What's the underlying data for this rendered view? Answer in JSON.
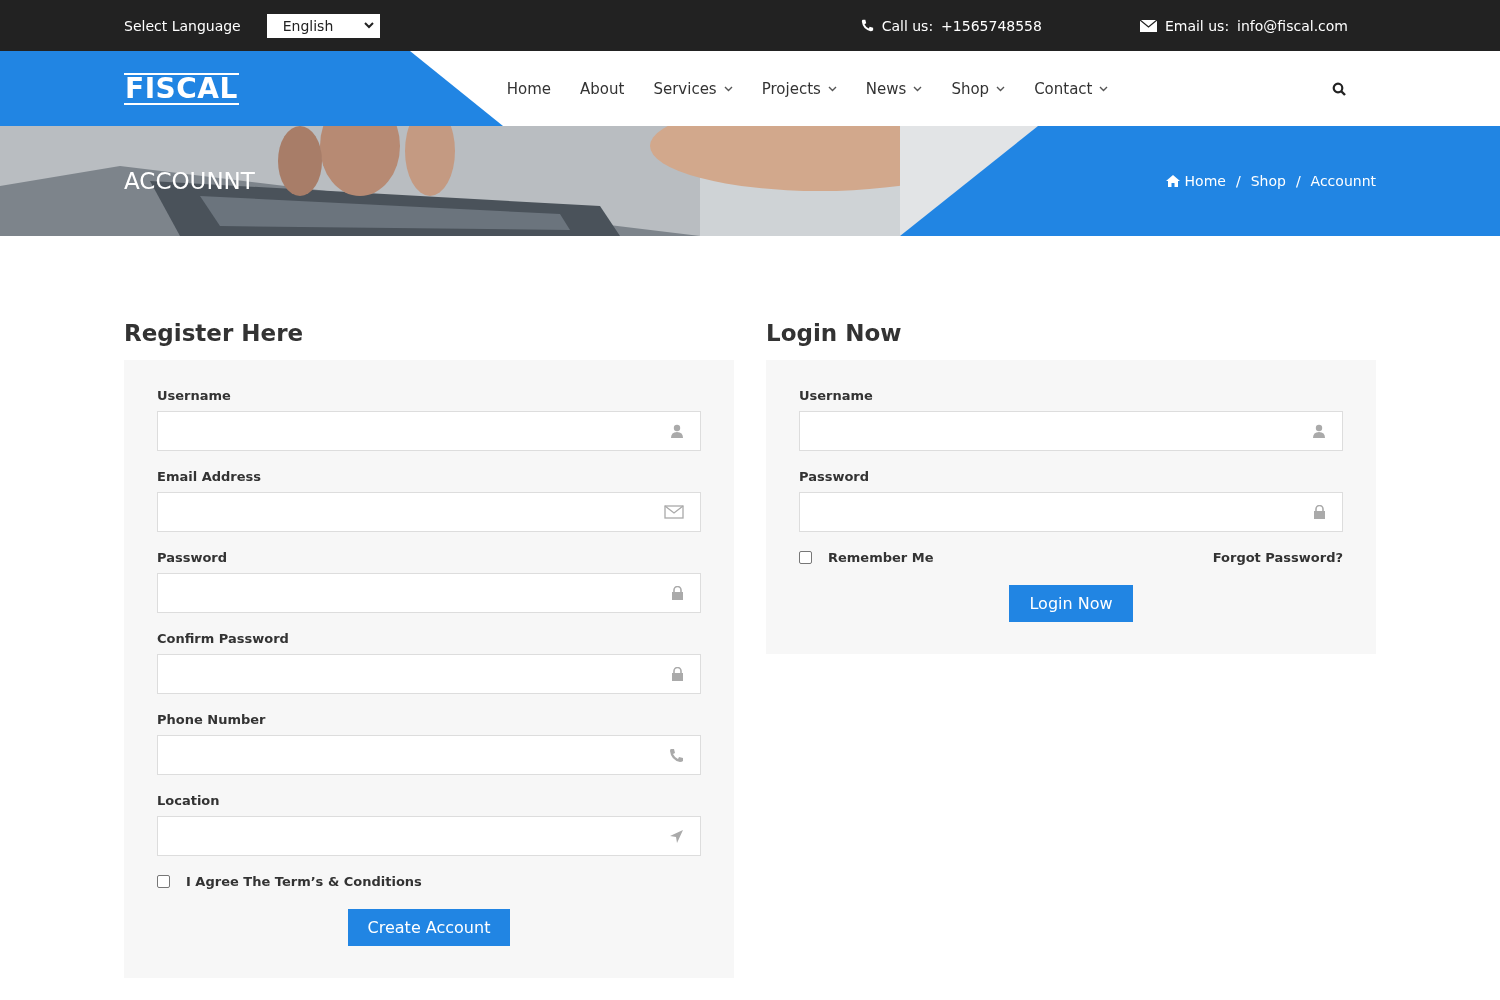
{
  "topbar": {
    "language_label": "Select Language",
    "language": "English",
    "call_label": "Call us:",
    "phone": "+1565748558",
    "email_label": "Email us:",
    "email": "info@fiscal.com"
  },
  "logo": "FISCAL",
  "nav": [
    {
      "label": "Home",
      "dropdown": false
    },
    {
      "label": "About",
      "dropdown": false
    },
    {
      "label": "Services",
      "dropdown": true
    },
    {
      "label": "Projects",
      "dropdown": true
    },
    {
      "label": "News",
      "dropdown": true
    },
    {
      "label": "Shop",
      "dropdown": true
    },
    {
      "label": "Contact",
      "dropdown": true
    }
  ],
  "banner": {
    "kind": "picture",
    "title": "ACCOUNNT",
    "breadcrumb": [
      "Home",
      "Shop",
      "Accounnt"
    ],
    "separators": [
      "/",
      "/"
    ]
  },
  "register": {
    "title": "Register Here",
    "fields": [
      {
        "label": "Username",
        "kind": "user"
      },
      {
        "label": "Email Address",
        "kind": "mail"
      },
      {
        "label": "Password",
        "kind": "lock"
      },
      {
        "label": "Confirm Password",
        "kind": "lock"
      },
      {
        "label": "Phone Number",
        "kind": "phone"
      },
      {
        "label": "Location",
        "kind": "location"
      }
    ],
    "agree": {
      "label": "I Agree The Term’s & Conditions",
      "checked": false
    },
    "button": "Create Account"
  },
  "login": {
    "title": "Login Now",
    "fields": [
      {
        "label": "Username",
        "kind": "user"
      },
      {
        "label": "Password",
        "kind": "lock"
      }
    ],
    "remember": {
      "label": "Remember Me",
      "checked": false
    },
    "forgot": "Forgot Password?",
    "button": "Login Now"
  }
}
